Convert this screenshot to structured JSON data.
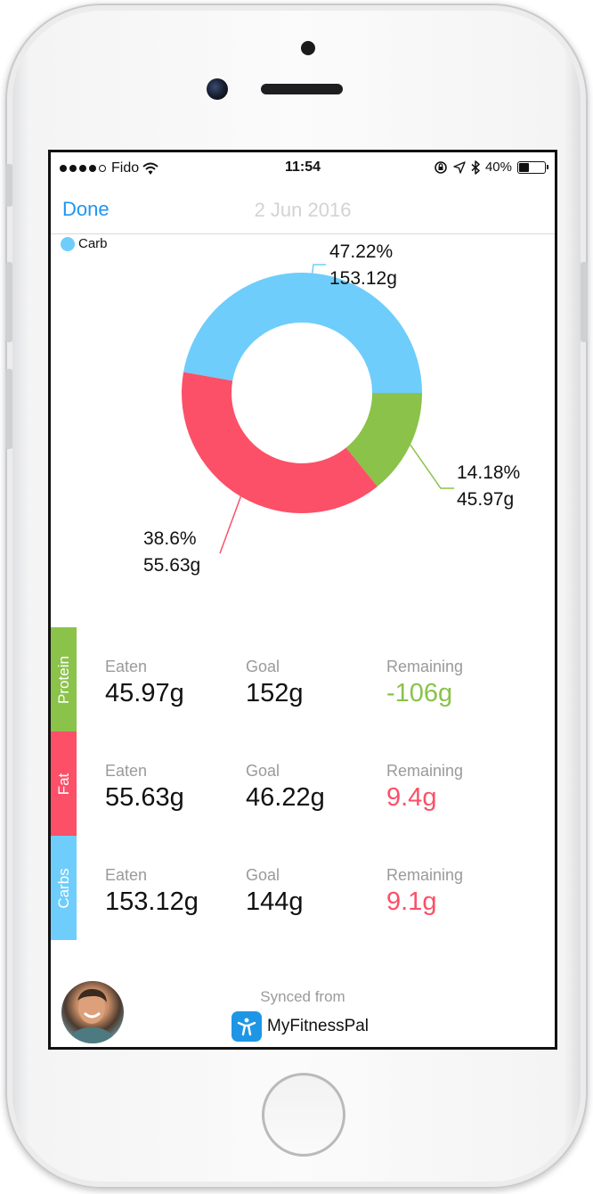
{
  "status_bar": {
    "carrier": "Fido",
    "time": "11:54",
    "battery": "40%",
    "battery_level": 0.4
  },
  "nav": {
    "done_label": "Done",
    "date": "2 Jun 2016"
  },
  "colors": {
    "carb": "#6ecdfb",
    "fat": "#fb5068",
    "protein": "#8ac24a",
    "accent": "#1e96f0"
  },
  "chart_data": {
    "type": "pie",
    "legend": [
      "Carb"
    ],
    "legend_position": "top-left",
    "slices": [
      {
        "macro": "carb",
        "percent": 47.22,
        "percent_label": "47.22%",
        "grams_label": "153.12g"
      },
      {
        "macro": "protein",
        "percent": 14.18,
        "percent_label": "14.18%",
        "grams_label": "45.97g"
      },
      {
        "macro": "fat",
        "percent": 38.6,
        "percent_label": "38.6%",
        "grams_label": "55.63g"
      }
    ]
  },
  "table": {
    "eaten_label": "Eaten",
    "goal_label": "Goal",
    "remaining_label": "Remaining",
    "rows": [
      {
        "name": "Protein",
        "eaten": "45.97g",
        "goal": "152g",
        "remaining": "-106g"
      },
      {
        "name": "Fat",
        "eaten": "55.63g",
        "goal": "46.22g",
        "remaining": "9.4g"
      },
      {
        "name": "Carbs",
        "eaten": "153.12g",
        "goal": "144g",
        "remaining": "9.1g"
      }
    ]
  },
  "footer": {
    "synced_label": "Synced from",
    "app_name": "MyFitnessPal"
  }
}
